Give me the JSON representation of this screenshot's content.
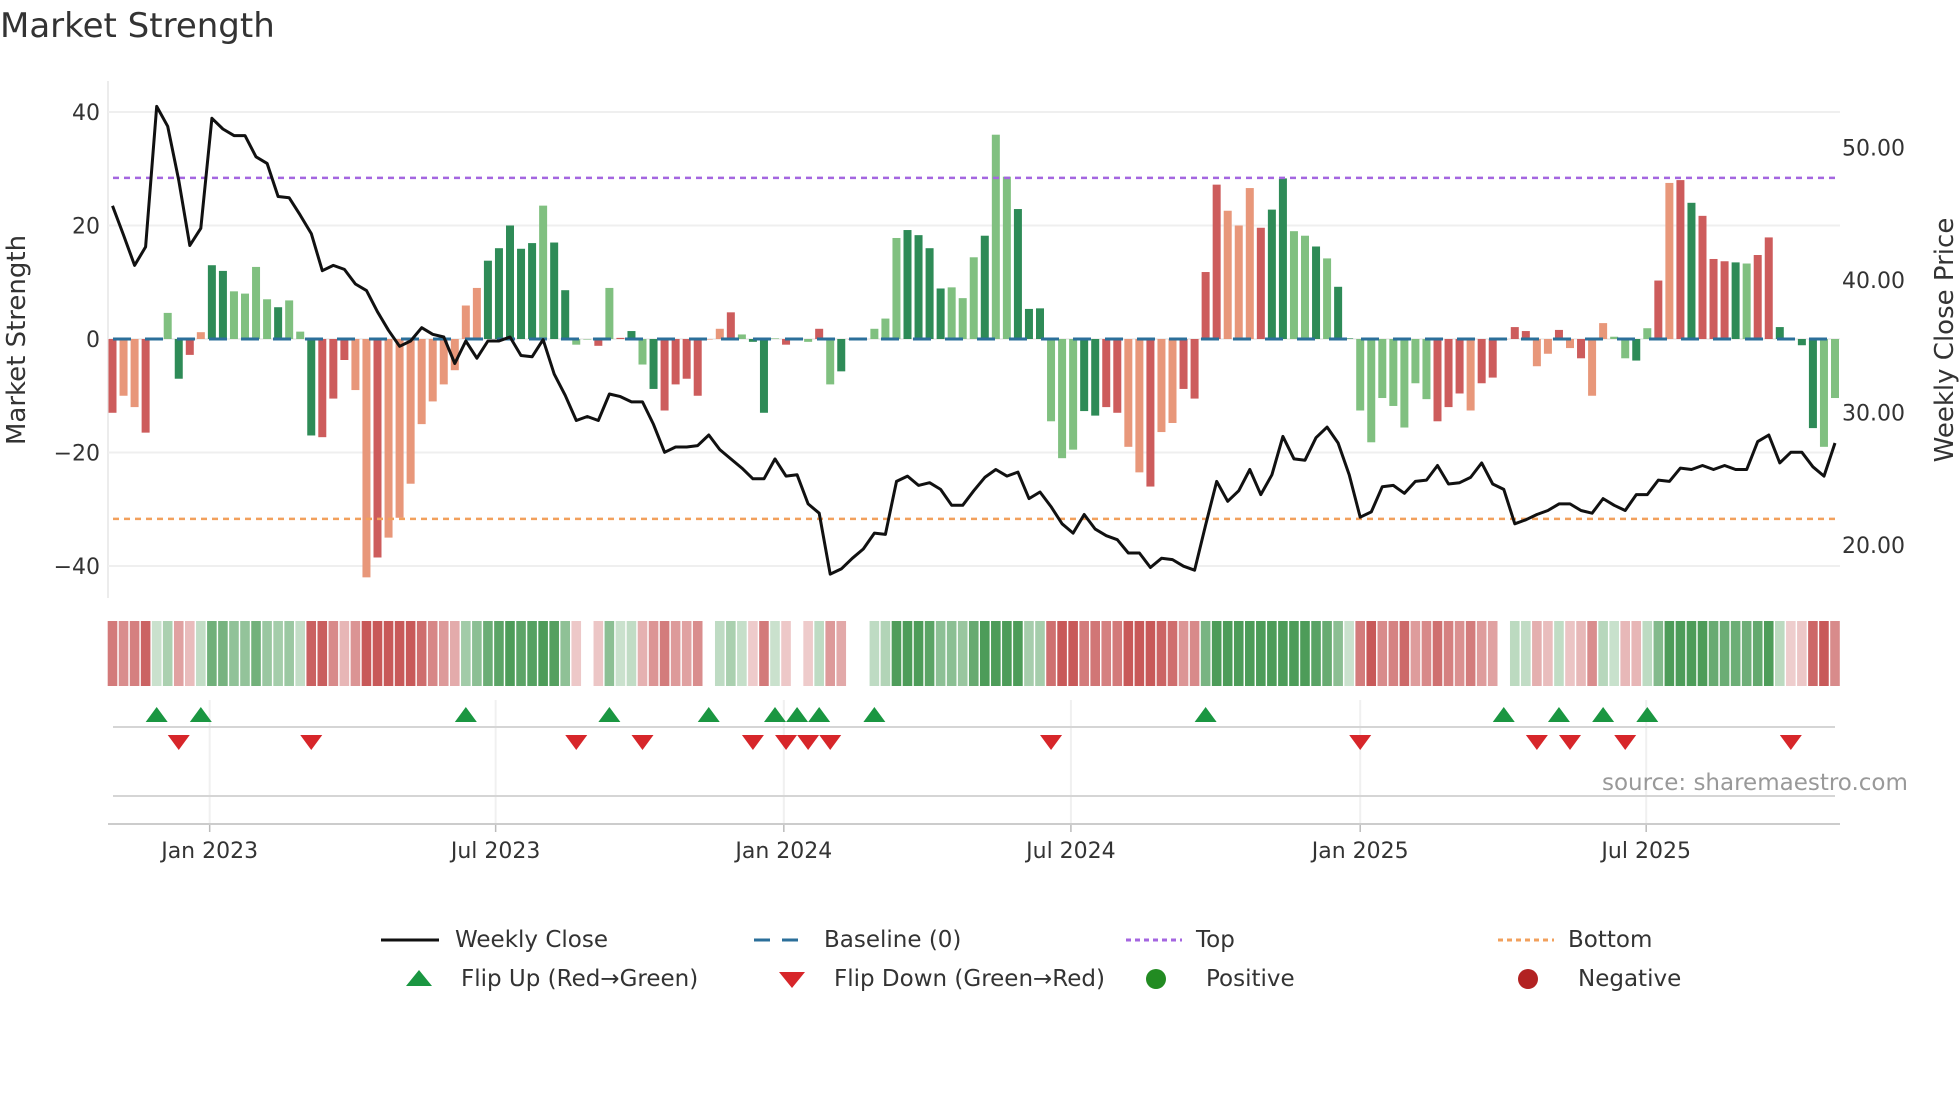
{
  "title": "Market Strength",
  "source": "source: sharemaestro.com",
  "chart_data": {
    "type": "bar",
    "title": "Market Strength",
    "ylabel": "Market Strength",
    "y2label": "Weekly Close Price",
    "ylim": [
      -45,
      45
    ],
    "y2lim": [
      15.5,
      56
    ],
    "yticks": [
      {
        "v": 40,
        "label": "40"
      },
      {
        "v": 20,
        "label": "20"
      },
      {
        "v": 0,
        "label": "0"
      },
      {
        "v": -20,
        "label": "−20"
      },
      {
        "v": -40,
        "label": "−40"
      }
    ],
    "y2ticks": [
      {
        "v": 50,
        "label": "50.00"
      },
      {
        "v": 40,
        "label": "40.00"
      },
      {
        "v": 30,
        "label": "30.00"
      },
      {
        "v": 20,
        "label": "20.00"
      }
    ],
    "xticks": [
      {
        "week": 8.8,
        "label": "Jan 2023"
      },
      {
        "week": 34.7,
        "label": "Jul 2023"
      },
      {
        "week": 60.8,
        "label": "Jan 2024"
      },
      {
        "week": 86.8,
        "label": "Jul 2024"
      },
      {
        "week": 113,
        "label": "Jan 2025"
      },
      {
        "week": 138.9,
        "label": "Jul 2025"
      }
    ],
    "top": 28.4,
    "bottom": -31.7,
    "baseline": 0,
    "strength": [
      -13,
      -10,
      -12,
      -16.5,
      0.2,
      4.6,
      -7,
      -2.8,
      1.2,
      13,
      12,
      8.4,
      8,
      12.7,
      7,
      5.6,
      6.8,
      1.3,
      -17,
      -17.3,
      -10.5,
      -3.7,
      -9,
      -42,
      -38.5,
      -35,
      -31.5,
      -25.5,
      -15,
      -11,
      -8,
      -5.5,
      5.9,
      9,
      13.8,
      16,
      20,
      15.9,
      16.9,
      23.5,
      17,
      8.6,
      -1,
      0,
      -1.2,
      9,
      0.2,
      1.4,
      -4.5,
      -8.8,
      -12.6,
      -8,
      -7,
      -10,
      0,
      1.8,
      4.7,
      0.8,
      -0.5,
      -13,
      0.1,
      -1,
      0,
      -0.5,
      1.8,
      -8,
      -5.7,
      0,
      0,
      1.8,
      3.6,
      17.8,
      19.2,
      18.3,
      16,
      8.9,
      9.1,
      7.2,
      14.4,
      18.2,
      36,
      28.6,
      22.9,
      5.3,
      5.4,
      -14.5,
      -21,
      -19.5,
      -12.7,
      -13.5,
      -12,
      -13,
      -19,
      -23.5,
      -26,
      -16.4,
      -14.8,
      -8.8,
      -10.5,
      11.8,
      27.2,
      22.6,
      20,
      26.6,
      19.6,
      22.8,
      28.3,
      19,
      18.2,
      16.3,
      14.2,
      9.2,
      0.1,
      -12.6,
      -18.2,
      -10.4,
      -11.8,
      -15.6,
      -7.8,
      -10.6,
      -14.5,
      -12,
      -9.6,
      -12.6,
      -7.8,
      -6.8,
      0,
      2.1,
      1.4,
      -4.8,
      -2.6,
      1.6,
      -1.6,
      -3.4,
      -10,
      2.8,
      0.4,
      -3.4,
      -3.8,
      1.9,
      10.3,
      27.5,
      28,
      24,
      21.7,
      14.1,
      13.7,
      13.5,
      13.3,
      14.8,
      17.9,
      2.1,
      -0.1,
      -1.1,
      -15.7,
      -19,
      -10.4
    ],
    "states": "roorrgGroGGggggGggGrrrooroooooooooGGGGGgGGggrgrGgGrrrroorgGGgrrgrgGrogggGGGGgggGggGGGgggGGrrooroorrrrooorGGggGgGGgggggggrrrorrorroororooggGgrorGrrrGgrrGGGGggggggGGggrrro",
    "close": [
      45.6,
      43.4,
      41.1,
      42.5,
      53.1,
      51.6,
      47.5,
      42.6,
      43.9,
      52.2,
      51.4,
      50.9,
      50.9,
      49.3,
      48.8,
      46.3,
      46.2,
      44.9,
      43.5,
      40.7,
      41.1,
      40.8,
      39.7,
      39.2,
      37.6,
      36.2,
      35,
      35.4,
      36.4,
      35.9,
      35.7,
      33.7,
      35.4,
      34.1,
      35.4,
      35.4,
      35.7,
      34.3,
      34.2,
      35.5,
      32.9,
      31.3,
      29.4,
      29.7,
      29.4,
      31.4,
      31.2,
      30.8,
      30.8,
      29.1,
      27,
      27.4,
      27.4,
      27.5,
      28.3,
      27.2,
      26.5,
      25.8,
      25,
      25,
      26.5,
      25.2,
      25.3,
      23.1,
      22.4,
      17.8,
      18.2,
      19,
      19.7,
      20.9,
      20.8,
      24.8,
      25.2,
      24.5,
      24.7,
      24.2,
      23,
      23,
      24.1,
      25.1,
      25.7,
      25.2,
      25.5,
      23.5,
      24,
      22.9,
      21.6,
      20.9,
      22.3,
      21.2,
      20.7,
      20.4,
      19.4,
      19.4,
      18.3,
      19,
      18.9,
      18.4,
      18.1,
      21.5,
      24.8,
      23.3,
      24.1,
      25.7,
      23.8,
      25.3,
      28.2,
      26.5,
      26.4,
      28.1,
      28.9,
      27.7,
      25.3,
      22.1,
      22.5,
      24.4,
      24.5,
      23.9,
      24.8,
      24.9,
      26,
      24.6,
      24.7,
      25.1,
      26.2,
      24.6,
      24.2,
      21.6,
      21.9,
      22.3,
      22.6,
      23.1,
      23.1,
      22.6,
      22.4,
      23.5,
      23,
      22.6,
      23.8,
      23.8,
      24.9,
      24.8,
      25.8,
      25.7,
      26,
      25.7,
      26,
      25.7,
      25.7,
      27.8,
      28.3,
      26.2,
      27,
      27,
      25.9,
      25.2,
      27.7
    ],
    "flip_up_weeks": [
      4,
      8,
      32,
      45,
      54,
      60,
      62,
      64,
      69,
      99,
      126,
      131,
      135,
      139
    ],
    "flip_down_weeks": [
      6,
      18,
      42,
      48,
      58,
      61,
      63,
      65,
      85,
      113,
      129,
      132,
      137,
      152
    ],
    "colors": {
      "strong_pos": "#2e8b57",
      "weak_pos": "#80c080",
      "strong_neg": "#cd5c5c",
      "weak_neg": "#e8977a",
      "baseline": "#2b6f9a",
      "top": "#a466e0",
      "bottom": "#f2a05c",
      "close": "#111111",
      "flip_up": "#1a9641",
      "flip_down": "#d7262a",
      "positive": "#228b22",
      "negative": "#b22222"
    }
  },
  "legend": {
    "weekly_close": "Weekly Close",
    "baseline": "Baseline (0)",
    "top": "Top",
    "bottom": "Bottom",
    "flip_up": "Flip Up (Red→Green)",
    "flip_down": "Flip Down (Green→Red)",
    "positive": "Positive",
    "negative": "Negative"
  }
}
